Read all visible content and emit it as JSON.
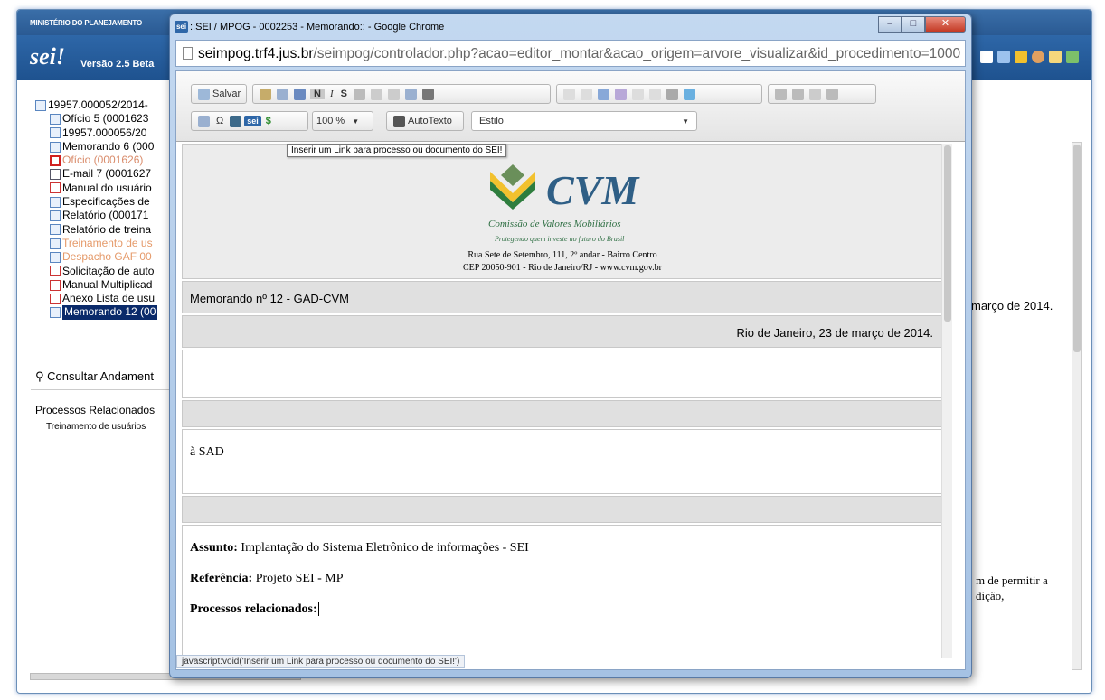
{
  "app": {
    "ministry": "MINISTÉRIO DO PLANEJAMENTO",
    "logo": "sei!",
    "version": "Versão 2.5 Beta"
  },
  "tree": {
    "root": "19957.000052/2014-",
    "items": [
      {
        "label": "Ofício 5 (0001623",
        "icon": "document-icon",
        "color": "#000000"
      },
      {
        "label": "19957.000056/20",
        "icon": "process-link-icon",
        "color": "#000000"
      },
      {
        "label": "Memorando 6 (000",
        "icon": "document-icon",
        "color": "#000000"
      },
      {
        "label": "Ofício (0001626)",
        "icon": "forbidden-icon",
        "color": "#d98b6a"
      },
      {
        "label": "E-mail 7 (0001627",
        "icon": "email-icon",
        "color": "#000000"
      },
      {
        "label": "Manual do usuário",
        "icon": "pdf-icon",
        "color": "#000000"
      },
      {
        "label": "Especificações de",
        "icon": "spreadsheet-icon",
        "color": "#000000"
      },
      {
        "label": "Relatório (000171",
        "icon": "document-icon",
        "color": "#000000"
      },
      {
        "label": "Relatório de treina",
        "icon": "image-icon",
        "color": "#000000"
      },
      {
        "label": "Treinamento de us",
        "icon": "document-icon",
        "color": "#e59a6a"
      },
      {
        "label": "Despacho GAF 00",
        "icon": "document-icon",
        "color": "#e59a6a"
      },
      {
        "label": "Solicitação de auto",
        "icon": "pdf-icon",
        "color": "#000000"
      },
      {
        "label": "Manual Multiplicad",
        "icon": "pdf-icon",
        "color": "#000000"
      },
      {
        "label": "Anexo Lista de usu",
        "icon": "pdf-icon",
        "color": "#000000"
      },
      {
        "label": "Memorando 12 (00",
        "icon": "document-icon",
        "color": "#ffffff",
        "selected": true
      }
    ]
  },
  "sidebar": {
    "consultar": "Consultar Andament",
    "processos_relacionados": "Processos Relacionados",
    "treinamento": "Treinamento de usuários"
  },
  "background_text": {
    "date_fragment": "março de 2014.",
    "line1": "m de permitir a",
    "line2": "dição,"
  },
  "popup": {
    "title": "::SEI / MPOG - 0002253 - Memorando:: - Google Chrome",
    "address_host": "seimpog.trf4.jus.br",
    "address_path": "/seimpog/controlador.php?acao=editor_montar&acao_origem=arvore_visualizar&id_procedimento=1000",
    "toolbar": {
      "salvar": "Salvar",
      "zoom": "100 %",
      "autotexto": "AutoTexto",
      "estilo": "Estilo",
      "bold": "N",
      "italic": "I",
      "underline": "S",
      "sei_button": "sei"
    },
    "tooltip": "Inserir um Link para processo ou documento do SEI!",
    "status": "javascript:void('Inserir um Link para processo ou documento do SEI!')"
  },
  "document": {
    "org_name": "CVM",
    "org_full": "Comissão de Valores Mobiliários",
    "motto": "Protegendo quem investe no futuro do Brasil",
    "address1": "Rua Sete de Setembro, 111, 2º andar - Bairro Centro",
    "address2": "CEP 20050-901 - Rio de Janeiro/RJ - www.cvm.gov.br",
    "memo_number": "Memorando nº 12 - GAD-CVM",
    "date": "Rio de Janeiro, 23 de março de 2014.",
    "recipient": "à SAD",
    "assunto_label": "Assunto:",
    "assunto_value": " Implantação do Sistema Eletrônico de informações - SEI",
    "referencia_label": "Referência:",
    "referencia_value": " Projeto SEI - MP",
    "processos_label": "Processos relacionados:"
  },
  "colors": {
    "header_blue": "#2e67a8",
    "cvm_blue": "#2f5f86",
    "cvm_green": "#2e6f43",
    "cvm_yellow": "#f2c12e",
    "selected_bg": "#0a2a6a"
  }
}
